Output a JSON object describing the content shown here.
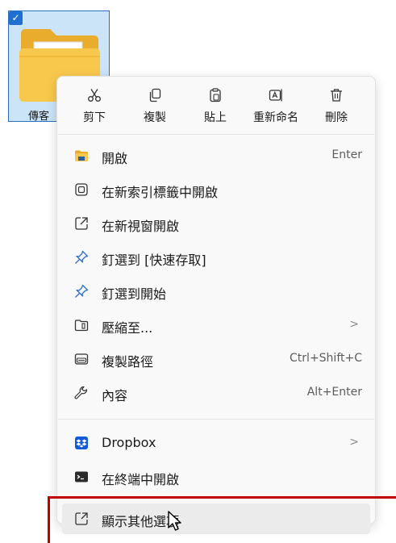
{
  "folder": {
    "name": "傳客",
    "checked": true
  },
  "actions": [
    {
      "label": "剪下",
      "icon": "cut-icon"
    },
    {
      "label": "複製",
      "icon": "copy-icon"
    },
    {
      "label": "貼上",
      "icon": "paste-icon"
    },
    {
      "label": "重新命名",
      "icon": "rename-icon"
    },
    {
      "label": "刪除",
      "icon": "delete-icon"
    }
  ],
  "items": [
    {
      "label": "開啟",
      "shortcut": "Enter",
      "icon": "folder-icon"
    },
    {
      "label": "在新索引標籤中開啟",
      "shortcut": "",
      "icon": "new-tab-icon"
    },
    {
      "label": "在新視窗開啟",
      "shortcut": "",
      "icon": "new-window-icon"
    },
    {
      "label": "釘選到 [快速存取]",
      "shortcut": "",
      "icon": "pin-icon"
    },
    {
      "label": "釘選到開始",
      "shortcut": "",
      "icon": "pin-icon"
    },
    {
      "label": "壓縮至...",
      "shortcut": "",
      "submenu": ">",
      "icon": "compress-icon"
    },
    {
      "label": "複製路徑",
      "shortcut": "Ctrl+Shift+C",
      "icon": "copy-path-icon"
    },
    {
      "label": "內容",
      "shortcut": "Alt+Enter",
      "icon": "properties-icon"
    },
    {
      "label": "Dropbox",
      "shortcut": "",
      "submenu": ">",
      "icon": "dropbox-icon"
    },
    {
      "label": "在終端中開啟",
      "shortcut": "",
      "icon": "terminal-icon"
    },
    {
      "label": "顯示其他選項",
      "shortcut": "",
      "icon": "more-options-icon"
    }
  ],
  "colors": {
    "accent": "#1f6fd1",
    "dropbox": "#0f5bd9",
    "folder": "#f8c84d",
    "highlight_box": "#c00000"
  }
}
